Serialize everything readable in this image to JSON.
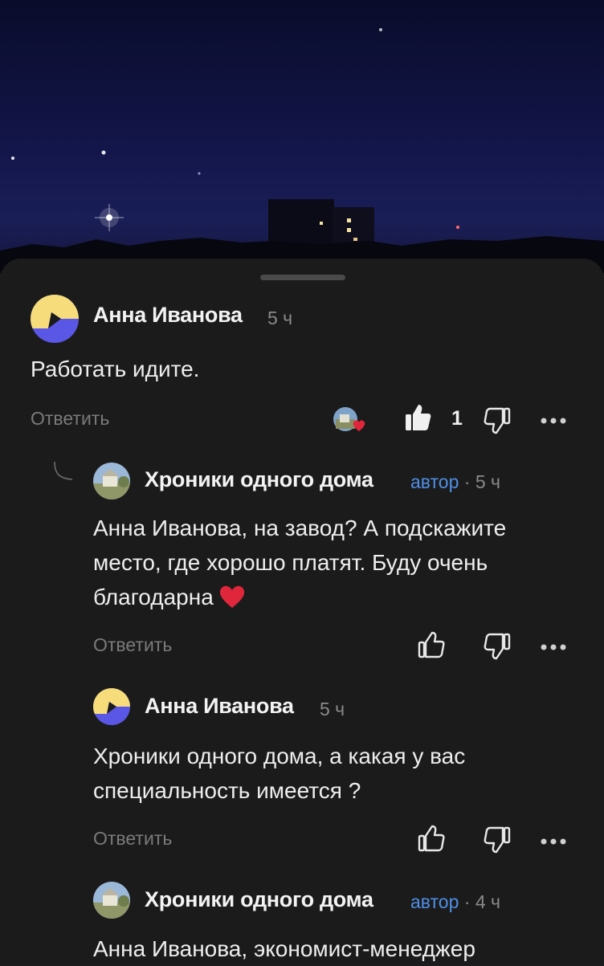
{
  "comments": [
    {
      "author": "Анна Иванова",
      "time": "5 ч",
      "text": "Работать идите.",
      "reply_label": "Ответить",
      "likes": "1",
      "avatar_icon": "yellow-purple-logo-avatar"
    },
    {
      "author": "Хроники одного дома",
      "author_tag": "автор",
      "separator": " · ",
      "time": "5 ч",
      "text": "Анна Иванова, на завод? А подскажите место, где хорошо платят. Буду очень благодарна",
      "reply_label": "Ответить",
      "avatar_icon": "house-photo-avatar"
    },
    {
      "author": "Анна Иванова",
      "time": "5 ч",
      "text": "Хроники одного дома, а какая у вас специальность имеется ?",
      "reply_label": "Ответить",
      "avatar_icon": "yellow-purple-logo-avatar"
    },
    {
      "author": "Хроники одного дома",
      "author_tag": "автор",
      "separator": " · ",
      "time": "4 ч",
      "text": "Анна Иванова, экономист-менеджер",
      "avatar_icon": "house-photo-avatar"
    }
  ],
  "colors": {
    "sheet_bg": "#1b1b1b",
    "author_tag": "#4f8fe6",
    "heart": "#e0263a",
    "avatar_yellow": "#f6dc7a",
    "avatar_purple": "#5b57e6"
  }
}
